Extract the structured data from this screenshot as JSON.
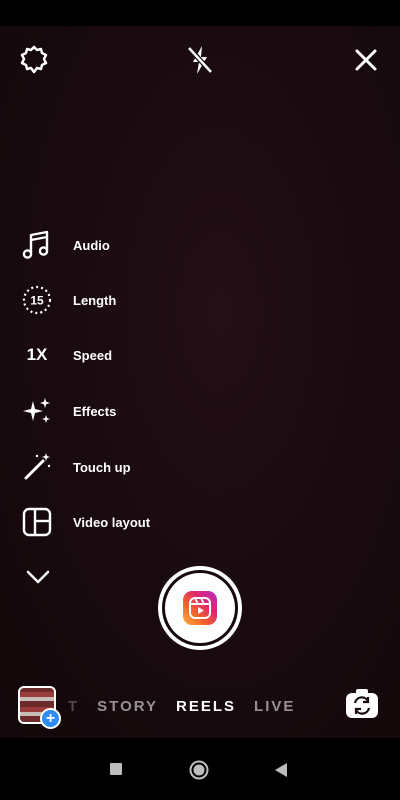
{
  "tools": [
    {
      "label": "Audio",
      "icon": "music-note-icon"
    },
    {
      "label": "Length",
      "icon": "timer-icon",
      "badge": "15"
    },
    {
      "label": "Speed",
      "icon": "speed-icon",
      "badge": "1X"
    },
    {
      "label": "Effects",
      "icon": "sparkles-icon"
    },
    {
      "label": "Touch up",
      "icon": "magic-wand-icon"
    },
    {
      "label": "Video layout",
      "icon": "layout-icon"
    }
  ],
  "modes": [
    "T",
    "STORY",
    "REELS",
    "LIVE"
  ],
  "active_mode": "REELS",
  "gallery_badge": "+",
  "colors": {
    "accent_blue": "#2f8cf4",
    "bg": "#1a0b10"
  }
}
